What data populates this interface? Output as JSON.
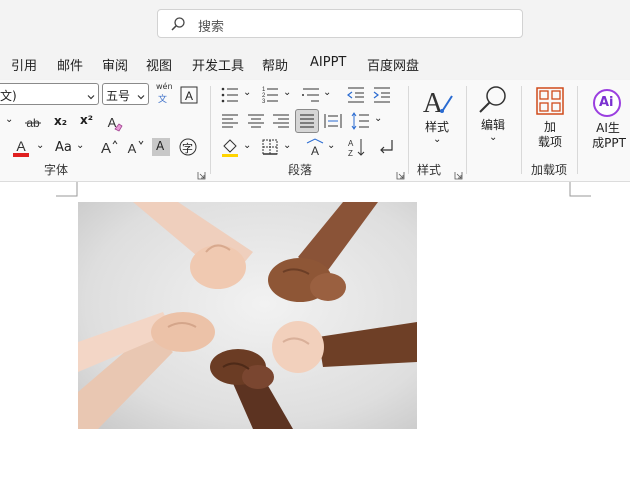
{
  "search": {
    "placeholder": "搜索"
  },
  "tabs": [
    {
      "label": "引用"
    },
    {
      "label": "邮件"
    },
    {
      "label": "审阅"
    },
    {
      "label": "视图"
    },
    {
      "label": "开发工具"
    },
    {
      "label": "帮助"
    },
    {
      "label": "AIPPT"
    },
    {
      "label": "百度网盘"
    }
  ],
  "font": {
    "font_name_value": "文)",
    "font_size_value": "五号",
    "phonetic_top": "wén",
    "phonetic_bottom": "文",
    "subscript_label": "x₂",
    "superscript_label": "x²",
    "change_case_label": "Aa",
    "char_shading_label": "A",
    "enclose_label": "字",
    "group_label": "字体"
  },
  "paragraph": {
    "group_label": "段落"
  },
  "styles": {
    "button_label": "样式",
    "group_label": "样式"
  },
  "editing": {
    "button_label": "编辑"
  },
  "addins": {
    "button_line1": "加",
    "button_line2": "载项",
    "group_label": "加载项"
  },
  "ai": {
    "button_line1": "AI生",
    "button_line2": "成PPT",
    "icon_text": "Ai"
  },
  "colors": {
    "accent_red": "#e02020",
    "ribbon_bg": "#f9f9f9",
    "addin_orange": "#d04a1a",
    "ai_purple": "#9b3fe0"
  }
}
